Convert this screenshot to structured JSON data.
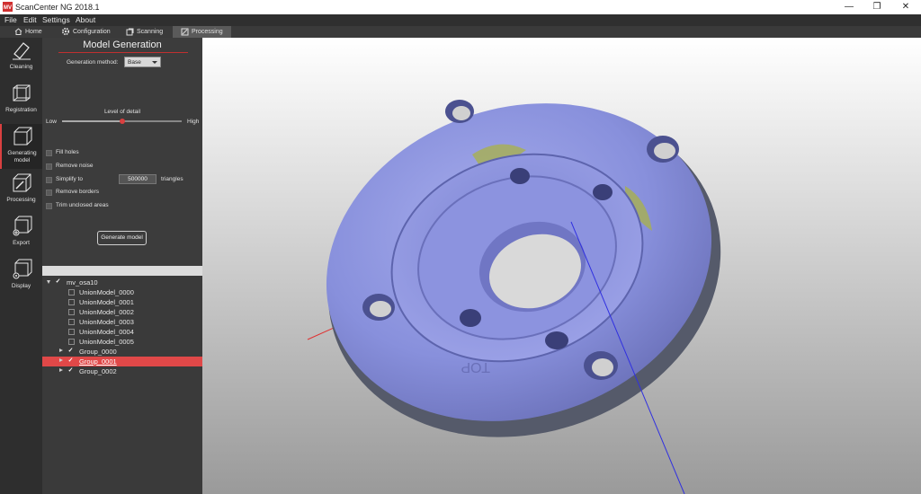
{
  "window": {
    "title": "ScanCenter NG 2018.1",
    "minimize_glyph": "—",
    "maximize_glyph": "❐",
    "close_glyph": "✕"
  },
  "menu": {
    "items": [
      "File",
      "Edit",
      "Settings",
      "About"
    ]
  },
  "tabs": [
    {
      "label": "Home",
      "icon": "home-icon"
    },
    {
      "label": "Configuration",
      "icon": "gear-icon"
    },
    {
      "label": "Scanning",
      "icon": "scan-icon"
    },
    {
      "label": "Processing",
      "icon": "processing-icon",
      "active": true
    }
  ],
  "tools": [
    {
      "label": "Cleaning",
      "icon": "eraser-icon"
    },
    {
      "label": "Registration",
      "icon": "registration-icon"
    },
    {
      "label": "Generating model",
      "icon": "cube-icon",
      "active": true
    },
    {
      "label": "Processing",
      "icon": "processing-icon"
    },
    {
      "label": "Export",
      "icon": "export-icon"
    },
    {
      "label": "Display",
      "icon": "display-icon"
    }
  ],
  "panel": {
    "title": "Model Generation",
    "generation_method_label": "Generation method:",
    "generation_method_value": "Base",
    "level_of_detail_label": "Level of detail",
    "level_low": "Low",
    "level_high": "High",
    "level_value": 0.5,
    "options": {
      "fill_holes": "Fill holes",
      "remove_noise": "Remove noise",
      "simplify_to": "Simplify to",
      "simplify_value": "500000",
      "simplify_suffix": "triangles",
      "remove_borders": "Remove borders",
      "trim_unclosed": "Trim unclosed areas"
    },
    "generate_button": "Generate model"
  },
  "tree": {
    "root": "mv_osa10",
    "union_models": [
      "UnionModel_0000",
      "UnionModel_0001",
      "UnionModel_0002",
      "UnionModel_0003",
      "UnionModel_0004",
      "UnionModel_0005"
    ],
    "groups": [
      "Group_0000",
      "Group_0001",
      "Group_0002"
    ],
    "selected_group": "Group_0001"
  },
  "viewport": {
    "engraved_text": "TOP"
  },
  "colors": {
    "accent": "#d94040",
    "mesh": "#8890dc",
    "axis_x": "#e03030",
    "axis_y": "#30c030",
    "axis_z": "#3030e0"
  }
}
